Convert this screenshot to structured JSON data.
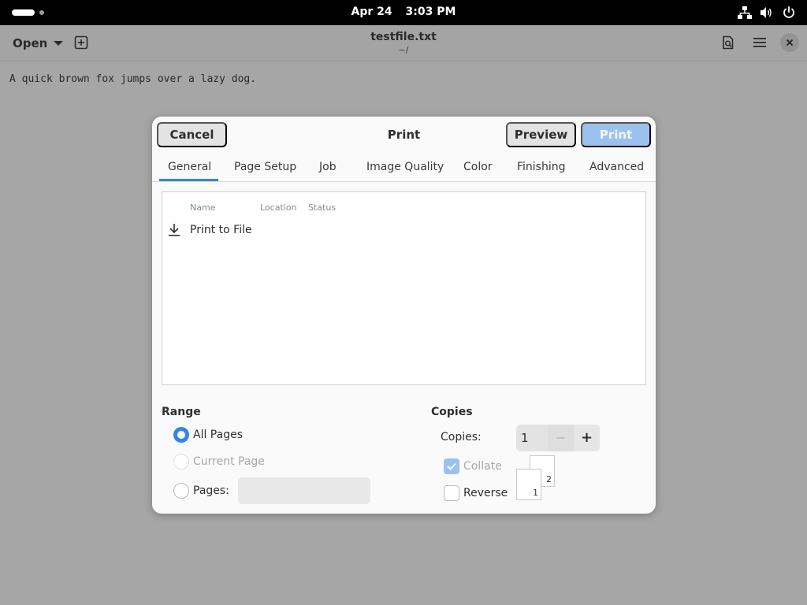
{
  "topbar": {
    "date": "Apr 24",
    "time": "3:03 PM",
    "icons": [
      "network-icon",
      "volume-icon",
      "power-icon"
    ]
  },
  "editor": {
    "open_label": "Open",
    "title": "testfile.txt",
    "subtitle": "~/",
    "content": "A quick brown fox jumps over a lazy dog."
  },
  "dialog": {
    "title": "Print",
    "cancel_label": "Cancel",
    "preview_label": "Preview",
    "print_label": "Print",
    "tabs": [
      {
        "label": "General",
        "active": true
      },
      {
        "label": "Page Setup"
      },
      {
        "label": "Job"
      },
      {
        "label": "Image Quality"
      },
      {
        "label": "Color"
      },
      {
        "label": "Finishing"
      },
      {
        "label": "Advanced"
      }
    ],
    "printer_columns": [
      "Name",
      "Location",
      "Status"
    ],
    "printers": [
      {
        "name": "Print to File",
        "icon": "download-icon"
      }
    ],
    "range": {
      "heading": "Range",
      "all_pages": "All Pages",
      "current_page": "Current Page",
      "pages": "Pages:",
      "pages_value": "",
      "selected": "all_pages"
    },
    "copies": {
      "heading": "Copies",
      "label": "Copies:",
      "value": "1",
      "collate": "Collate",
      "collate_checked": true,
      "reverse": "Reverse",
      "reverse_checked": false,
      "sheet_front": "1",
      "sheet_back": "2"
    }
  },
  "colors": {
    "accent": "#3584e4",
    "print_button": "#9bc2ef"
  }
}
